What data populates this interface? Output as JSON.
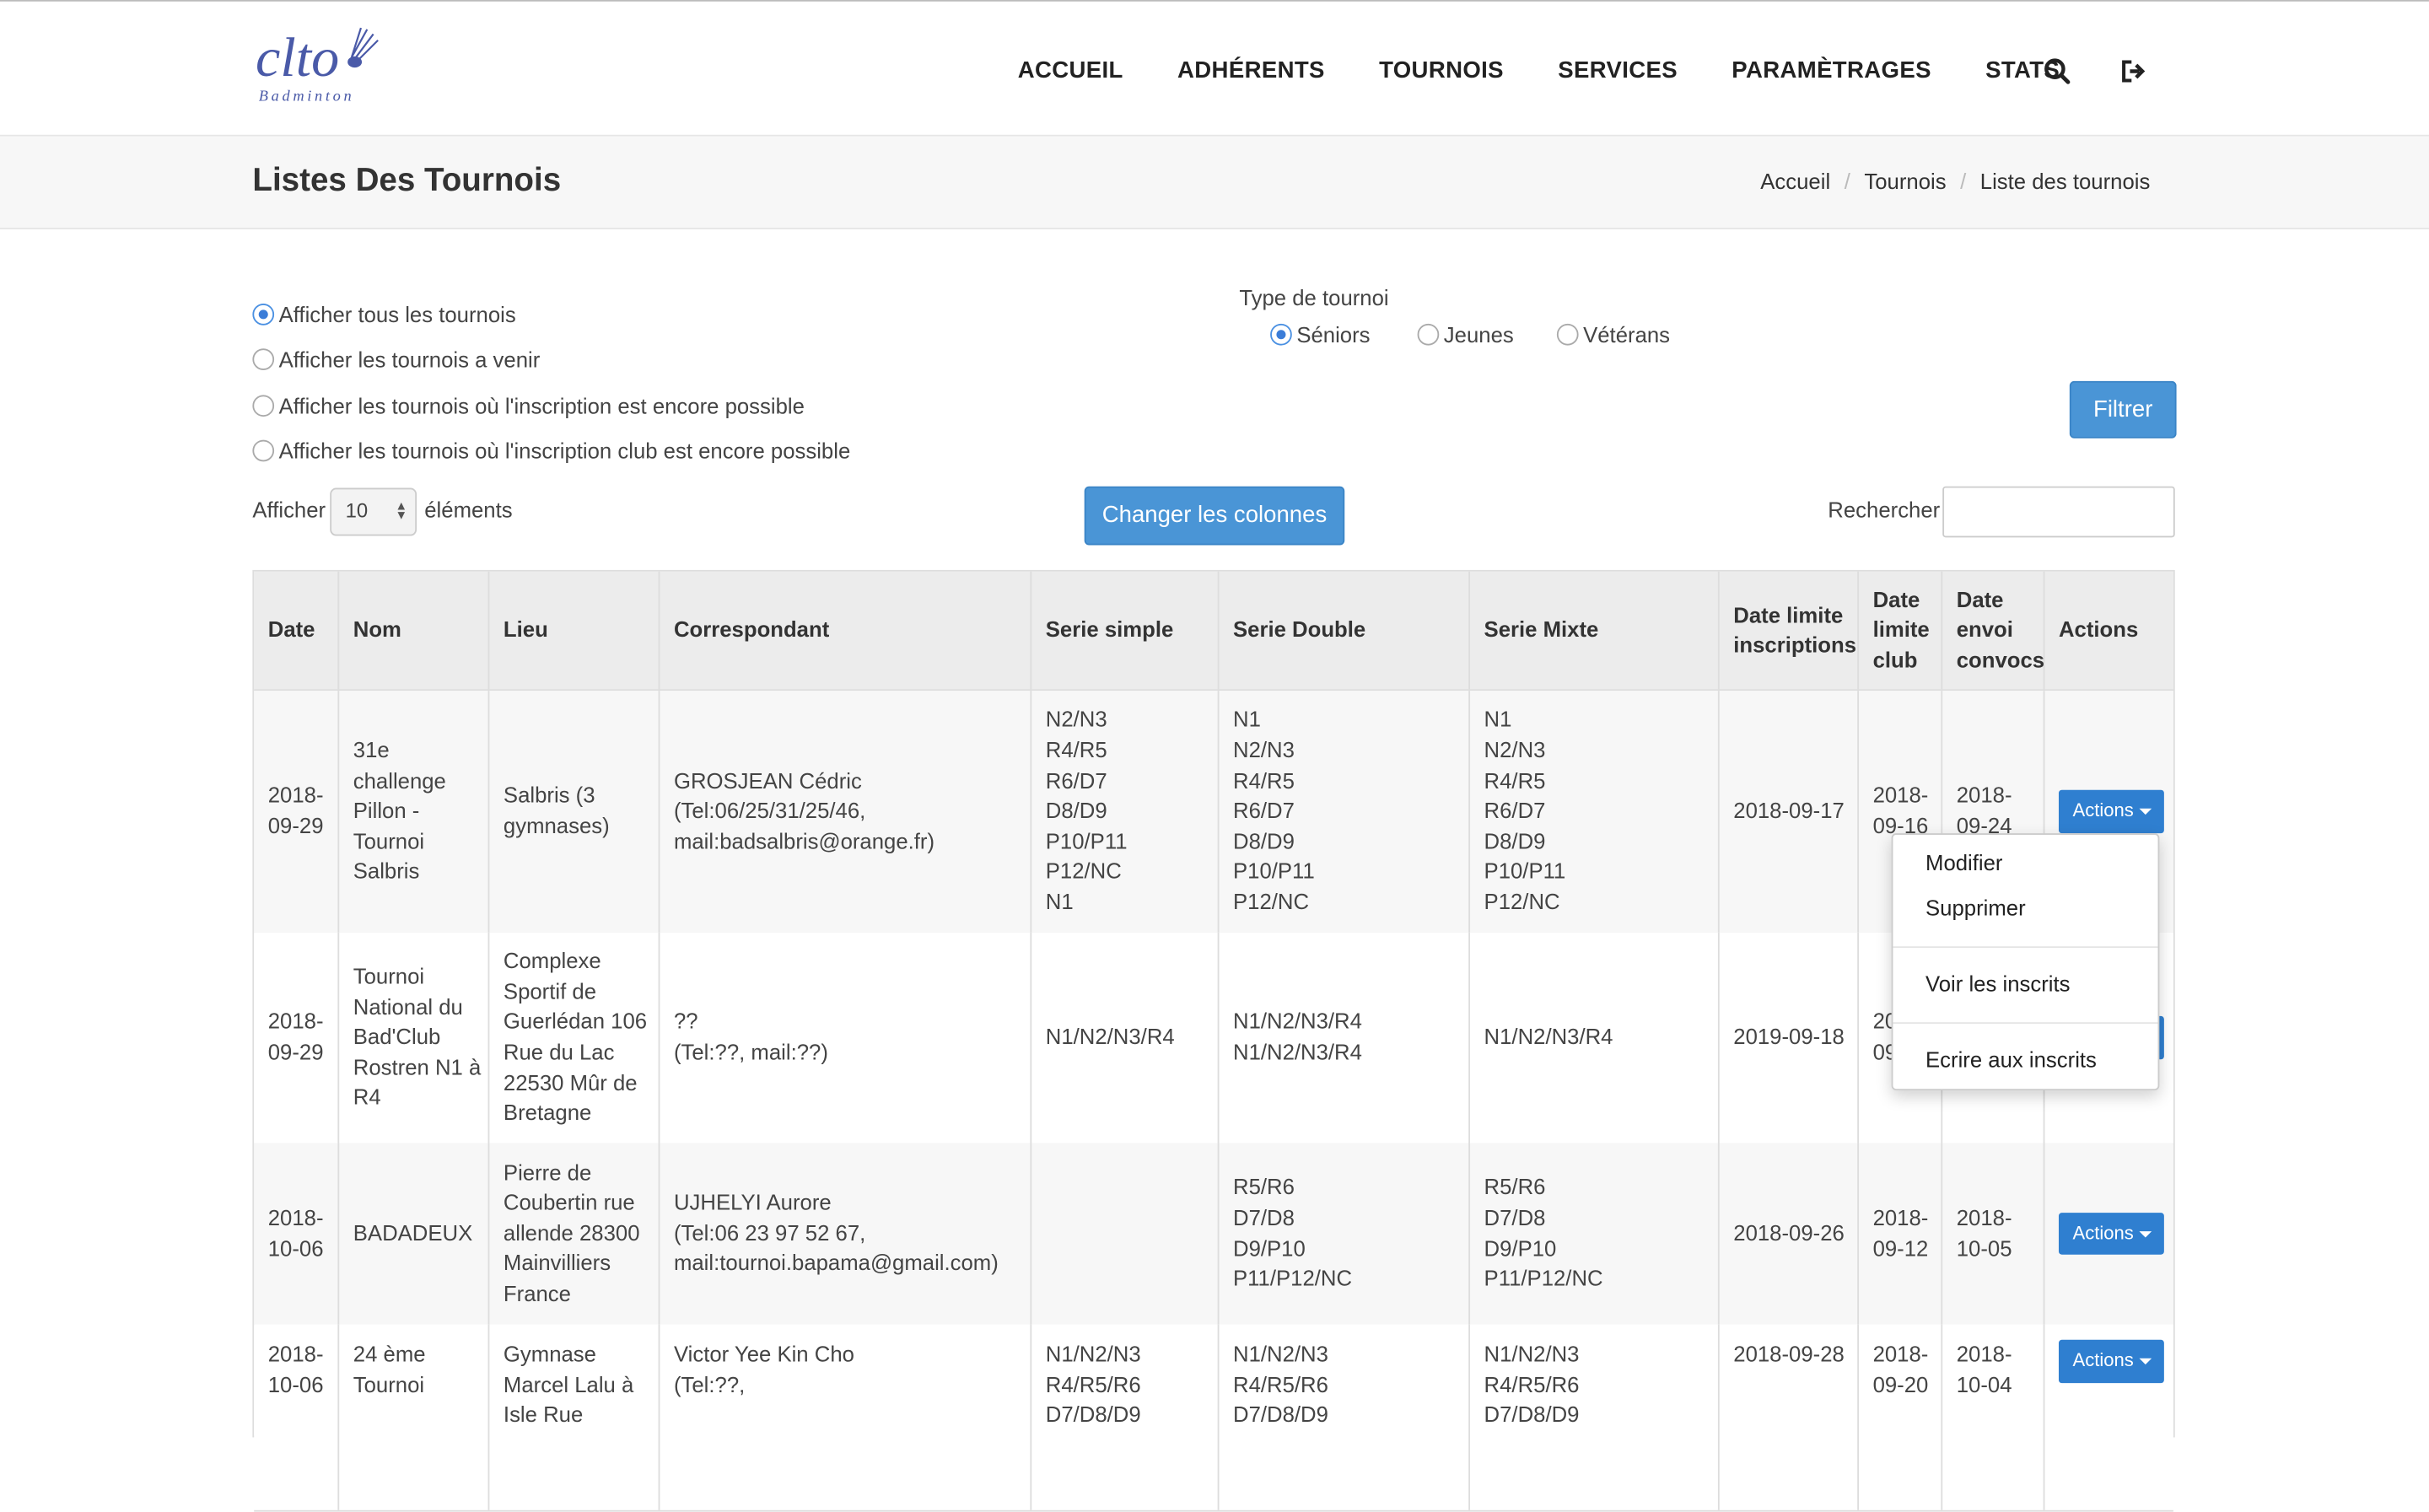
{
  "brand": {
    "logo_text": "clto",
    "logo_sub": "Badminton"
  },
  "nav": {
    "items": [
      "ACCUEIL",
      "ADHÉRENTS",
      "TOURNOIS",
      "SERVICES",
      "PARAMÈTRAGES",
      "STATS"
    ],
    "icons": [
      "search-icon",
      "logout-icon"
    ]
  },
  "page": {
    "title": "Listes Des Tournois",
    "breadcrumb": [
      "Accueil",
      "Tournois",
      "Liste des tournois"
    ]
  },
  "filters": {
    "options": [
      {
        "label": "Afficher tous les tournois",
        "checked": true
      },
      {
        "label": "Afficher les tournois a venir",
        "checked": false
      },
      {
        "label": "Afficher les tournois où l'inscription est encore possible",
        "checked": false
      },
      {
        "label": "Afficher les tournois où l'inscription club est encore possible",
        "checked": false
      }
    ],
    "type_label": "Type de tournoi",
    "types": [
      {
        "label": "Séniors",
        "checked": true
      },
      {
        "label": "Jeunes",
        "checked": false
      },
      {
        "label": "Vétérans",
        "checked": false
      }
    ],
    "filter_button": "Filtrer"
  },
  "controls": {
    "show_label": "Afficher",
    "page_size": "10",
    "elements_label": "éléments",
    "columns_button": "Changer les colonnes",
    "search_label": "Rechercher :",
    "search_value": ""
  },
  "table": {
    "headers": [
      "Date",
      "Nom",
      "Lieu",
      "Correspondant",
      "Serie simple",
      "Serie Double",
      "Serie Mixte",
      "Date limite inscriptions",
      "Date limite club",
      "Date envoi convocs",
      "Actions"
    ],
    "actions_label": "Actions",
    "rows": [
      [
        "2018-09-29",
        "31e challenge Pillon - Tournoi Salbris",
        "Salbris (3 gymnases)",
        "GROSJEAN Cédric (Tel:06/25/31/25/46, mail:badsalbris@orange.fr)",
        "N2/N3\nR4/R5\nR6/D7\nD8/D9\nP10/P11\nP12/NC\nN1",
        "N1\nN2/N3\nR4/R5\nR6/D7\nD8/D9\nP10/P11\nP12/NC",
        "N1\nN2/N3\nR4/R5\nR6/D7\nD8/D9\nP10/P11\nP12/NC",
        "2018-09-17",
        "2018-09-16",
        "2018-09-24"
      ],
      [
        "2018-09-29",
        "Tournoi National du Bad'Club Rostren N1 à R4",
        "Complexe Sportif de Guerlédan 106 Rue du Lac 22530 Mûr de Bretagne",
        "??\n(Tel:??, mail:??)",
        "N1/N2/N3/R4",
        "N1/N2/N3/R4\nN1/N2/N3/R4",
        "N1/N2/N3/R4",
        "2019-09-18",
        "2019-09-18",
        "2019-09-19"
      ],
      [
        "2018-10-06",
        "BADADEUX",
        "Pierre de Coubertin rue allende 28300 Mainvilliers France",
        "UJHELYI Aurore\n(Tel:06 23 97 52 67, mail:tournoi.bapama@gmail.com)",
        "",
        "R5/R6\nD7/D8\nD9/P10\nP11/P12/NC",
        "R5/R6\nD7/D8\nD9/P10\nP11/P12/NC",
        "2018-09-26",
        "2018-09-12",
        "2018-10-05"
      ],
      [
        "2018-10-06",
        "24 ème Tournoi",
        "Gymnase Marcel Lalu à Isle Rue",
        "Victor Yee Kin Cho\n(Tel:??,",
        "N1/N2/N3\nR4/R5/R6\nD7/D8/D9",
        "N1/N2/N3\nR4/R5/R6\nD7/D8/D9",
        "N1/N2/N3\nR4/R5/R6\nD7/D8/D9",
        "2018-09-28",
        "2018-09-20",
        "2018-10-04"
      ]
    ]
  },
  "dropdown": {
    "items": [
      "Modifier",
      "Supprimer",
      "Voir les inscrits",
      "Ecrire aux inscrits"
    ]
  },
  "colors": {
    "primary": "#4a95d6",
    "actions": "#2f7fd0",
    "header_bg": "#ececec"
  }
}
